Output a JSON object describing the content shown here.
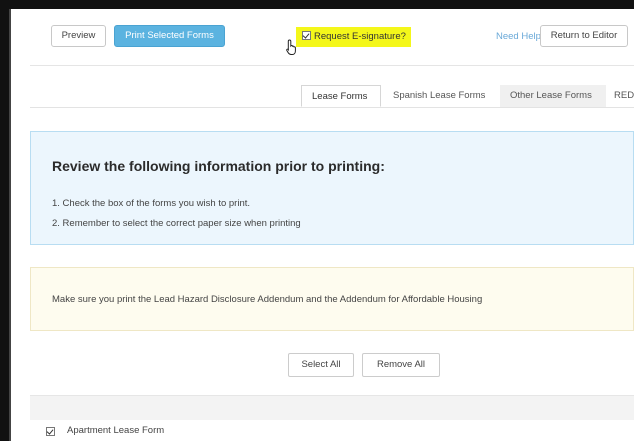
{
  "toolbar": {
    "preview_label": "Preview",
    "print_selected_label": "Print Selected Forms",
    "esignature_label": "Request E-signature?",
    "esignature_checked": true,
    "help_label": "Need Help?",
    "return_label": "Return to Editor"
  },
  "tabs": [
    {
      "label": "Lease Forms",
      "active": true
    },
    {
      "label": "Spanish Lease Forms",
      "active": false
    },
    {
      "label": "Other Lease Forms",
      "active": false
    },
    {
      "label": "REDE",
      "active": false
    }
  ],
  "info": {
    "title": "Review the following information prior to printing:",
    "items": [
      "1. Check the box of the forms you wish to print.",
      "2. Remember to select the correct paper size when printing"
    ]
  },
  "notice": {
    "text": "Make sure you print the Lead Hazard Disclosure Addendum and the Addendum for Affordable Housing"
  },
  "selection": {
    "select_all_label": "Select All",
    "remove_all_label": "Remove All"
  },
  "forms": [
    {
      "label": "Apartment Lease Form",
      "checked": true
    }
  ],
  "colors": {
    "primary": "#5bb3e0",
    "highlight": "#f4f71a",
    "info_bg": "#ecf6fd",
    "notice_bg": "#fefcef",
    "link": "#6aa9d8"
  }
}
